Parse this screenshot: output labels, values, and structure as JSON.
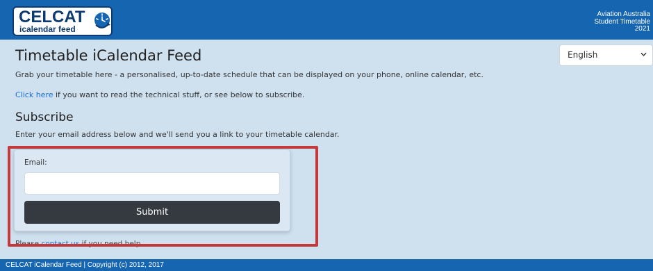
{
  "header": {
    "logo_title": "CELCAT",
    "logo_subtitle": "icalendar feed",
    "logo_icon": "clock-arrow-icon",
    "org_lines": [
      "Aviation Australia",
      "Student Timetable",
      "2021"
    ],
    "background": "#1565b0"
  },
  "language": {
    "selected": "English",
    "icon": "chevron-down-icon"
  },
  "main": {
    "title": "Timetable iCalendar Feed",
    "intro": "Grab your timetable here - a personalised, up-to-date schedule that can be displayed on your phone, online calendar, etc.",
    "tech_link": "Click here",
    "tech_rest": " if you want to read the technical stuff, or see below to subscribe.",
    "subscribe_heading": "Subscribe",
    "subscribe_text": "Enter your email address below and we'll send you a link to your timetable calendar."
  },
  "form": {
    "email_label": "Email:",
    "email_value": "",
    "submit_label": "Submit"
  },
  "help": {
    "prefix": "Please ",
    "link": "contact us",
    "suffix": " if you need help."
  },
  "footer": {
    "text": "CELCAT iCalendar Feed | Copyright (c) 2012, 2017"
  },
  "colors": {
    "page_background": "#cfe0ef",
    "link": "#1a6fd0",
    "submit_button": "#353a40",
    "highlight_border": "#c33a3c"
  }
}
